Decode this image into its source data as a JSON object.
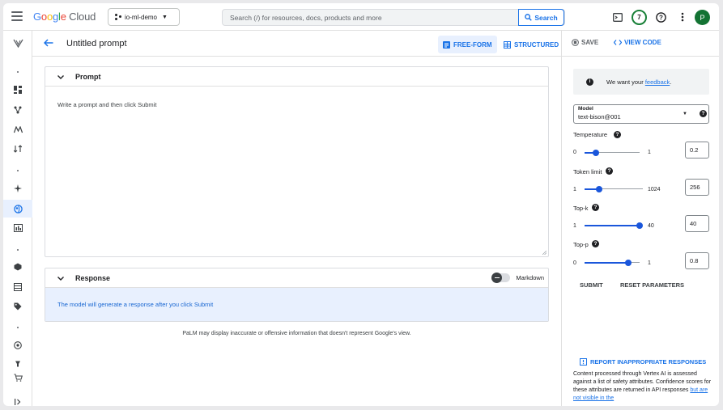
{
  "header": {
    "logo_word1": "Google",
    "logo_word2": "Cloud",
    "project": "io-ml-demo",
    "search_placeholder": "Search (/) for resources, docs, products and more",
    "search_button": "Search",
    "notifications_count": "7",
    "avatar_letter": "P"
  },
  "toolbar": {
    "title": "Untitled prompt",
    "free_form": "FREE-FORM",
    "structured": "STRUCTURED",
    "save": "SAVE",
    "view_code": "VIEW CODE"
  },
  "prompt": {
    "heading": "Prompt",
    "placeholder": "Write a prompt and then click Submit"
  },
  "response": {
    "heading": "Response",
    "markdown_label": "Markdown",
    "markdown_on": false,
    "message": "The model will generate a response after you click Submit"
  },
  "disclaimer": "PaLM may display inaccurate or offensive information that doesn't represent Google's view.",
  "panel": {
    "feedback_prefix": "We want your",
    "feedback_link": "feedback",
    "feedback_suffix": ".",
    "model_label": "Model",
    "model_value": "text-bison@001",
    "params": [
      {
        "label": "Temperature",
        "min": "0",
        "max": "1",
        "value": "0.2",
        "fraction": 0.2
      },
      {
        "label": "Token limit",
        "min": "1",
        "max": "1024",
        "value": "256",
        "fraction": 0.25
      },
      {
        "label": "Top-k",
        "min": "1",
        "max": "40",
        "value": "40",
        "fraction": 1.0
      },
      {
        "label": "Top-p",
        "min": "0",
        "max": "1",
        "value": "0.8",
        "fraction": 0.8
      }
    ],
    "submit": "SUBMIT",
    "reset": "RESET PARAMETERS",
    "report": "REPORT INAPPROPRIATE RESPONSES",
    "note_text": "Content processed through Vertex AI is assessed against a list of safety attributes. Confidence scores for these attributes are returned in API responses",
    "note_link": "but are not visible in the"
  },
  "colors": {
    "accent": "#1a73e8",
    "slider": "#1a56db",
    "response_bg": "#e8f0fe",
    "avatar": "#137333",
    "badge_ring": "#188038"
  }
}
